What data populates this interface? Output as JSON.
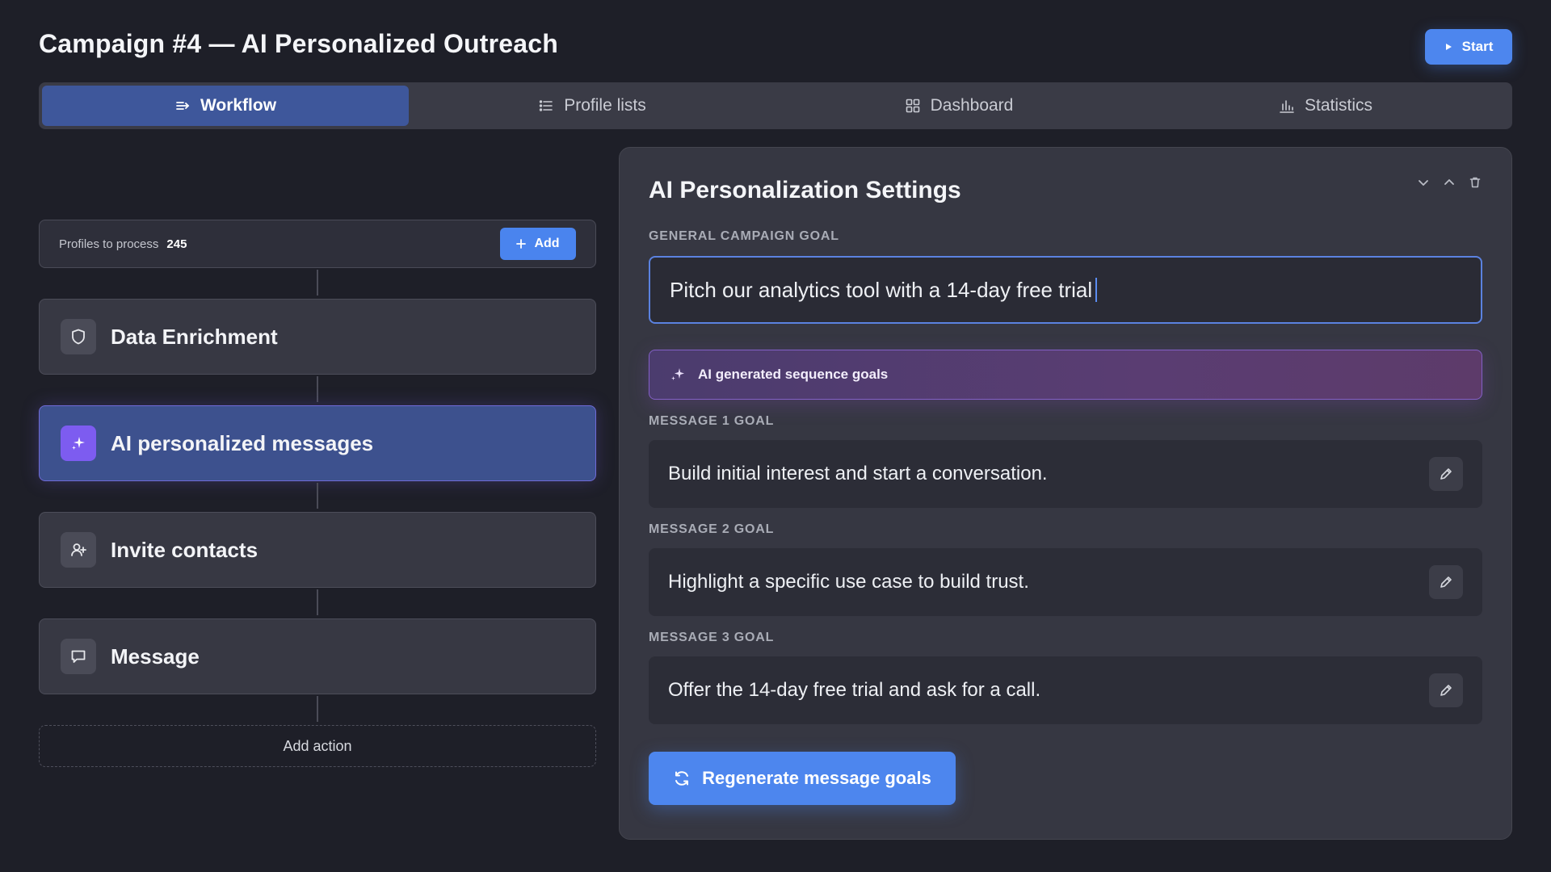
{
  "header": {
    "title": "Campaign #4 — AI Personalized Outreach",
    "start_label": "Start"
  },
  "tabs": [
    {
      "label": "Workflow",
      "icon": "workflow-icon",
      "active": true
    },
    {
      "label": "Profile lists",
      "icon": "list-icon",
      "active": false
    },
    {
      "label": "Dashboard",
      "icon": "grid-icon",
      "active": false
    },
    {
      "label": "Statistics",
      "icon": "bar-chart-icon",
      "active": false
    }
  ],
  "workflow": {
    "profiles_label": "Profiles to process",
    "profiles_count": "245",
    "add_label": "Add",
    "steps": [
      {
        "label": "Data Enrichment",
        "icon": "shield-icon",
        "active": false
      },
      {
        "label": "AI personalized messages",
        "icon": "sparkles-icon",
        "active": true
      },
      {
        "label": "Invite contacts",
        "icon": "user-plus-icon",
        "active": false
      },
      {
        "label": "Message",
        "icon": "chat-icon",
        "active": false
      }
    ],
    "add_action_label": "Add action"
  },
  "settings": {
    "title": "AI Personalization Settings",
    "general_goal_label": "GENERAL CAMPAIGN GOAL",
    "general_goal_value": "Pitch our analytics tool with a 14-day free trial",
    "ai_banner_label": "AI generated sequence goals",
    "messages": [
      {
        "label": "MESSAGE 1 GOAL",
        "value": "Build initial interest and start a conversation."
      },
      {
        "label": "MESSAGE 2 GOAL",
        "value": "Highlight a specific use case to build trust."
      },
      {
        "label": "MESSAGE 3 GOAL",
        "value": "Offer the 14-day free trial and ask for a call."
      }
    ],
    "regenerate_label": "Regenerate message goals"
  },
  "colors": {
    "background": "#1e1f28",
    "accent": "#4d86ee",
    "active_step": "#3d518e",
    "ai_purple": "#7d5cf0"
  }
}
